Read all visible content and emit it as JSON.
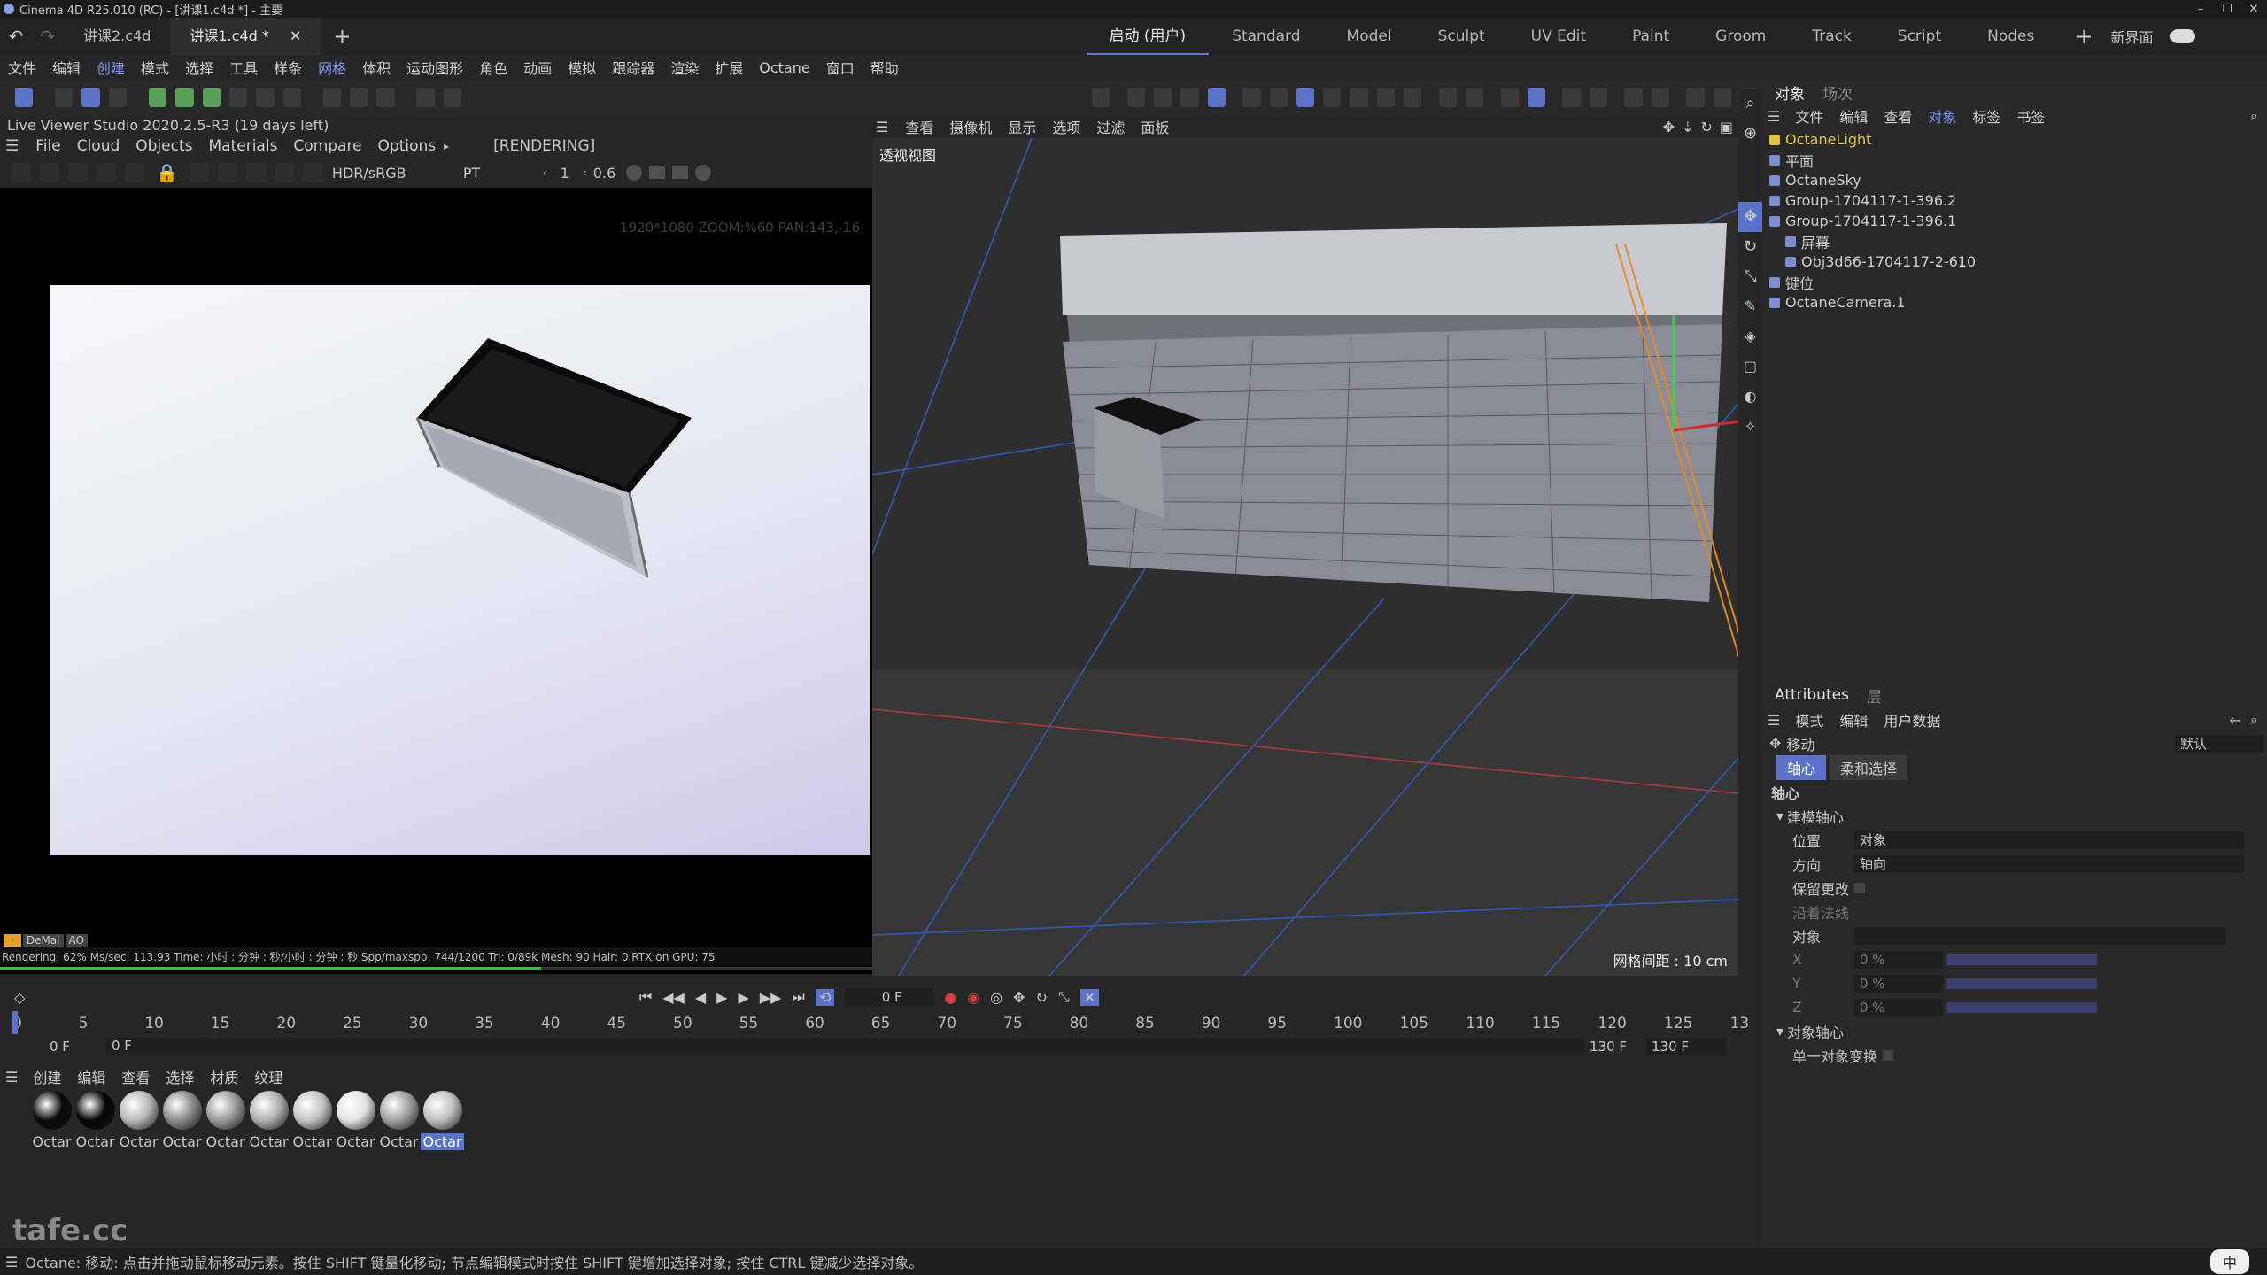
{
  "title_bar": {
    "text": "Cinema 4D R25.010 (RC) - [讲课1.c4d *] - 主要"
  },
  "doc_tabs": [
    {
      "label": "讲课2.c4d"
    },
    {
      "label": "讲课1.c4d *"
    }
  ],
  "layout_tabs": [
    "启动 (用户)",
    "Standard",
    "Model",
    "Sculpt",
    "UV Edit",
    "Paint",
    "Groom",
    "Track",
    "Script",
    "Nodes"
  ],
  "new_layout": "新界面",
  "main_menu": [
    "文件",
    "编辑",
    "创建",
    "模式",
    "选择",
    "工具",
    "样条",
    "网格",
    "体积",
    "运动图形",
    "角色",
    "动画",
    "模拟",
    "跟踪器",
    "渲染",
    "扩展",
    "Octane",
    "窗口",
    "帮助"
  ],
  "live_viewer": {
    "title": "Live Viewer Studio 2020.2.5-R3 (19 days left)",
    "menu": [
      "File",
      "Cloud",
      "Objects",
      "Materials",
      "Compare",
      "Options"
    ],
    "status_tag": "[RENDERING]",
    "color_space": "HDR/sRGB",
    "mode": "PT",
    "value1": "1",
    "value2": "0.6",
    "info": "1920*1080 ZOOM:%60  PAN:143,-16",
    "badges": [
      "DeMai",
      "AO"
    ],
    "status_line": "Rendering: 62%  Ms/sec: 113.93   Time: 小时 : 分钟 : 秒/小时 : 分钟 : 秒   Spp/maxspp: 744/1200   Tri: 0/89k   Mesh: 90   Hair: 0   RTX:on      GPU:    75",
    "progress": 0.62
  },
  "viewport": {
    "menu": [
      "查看",
      "摄像机",
      "显示",
      "选项",
      "过滤",
      "面板"
    ],
    "label": "透视视图",
    "grid_info": "网格间距 : 10 cm"
  },
  "object_panel": {
    "tabs": [
      "对象",
      "场次"
    ],
    "menu": [
      "文件",
      "编辑",
      "查看",
      "对象",
      "标签",
      "书签"
    ],
    "objects": [
      {
        "name": "OctaneLight",
        "indent": 0,
        "highlight": true
      },
      {
        "name": "平面",
        "indent": 0,
        "highlight": false
      },
      {
        "name": "OctaneSky",
        "indent": 0,
        "highlight": false
      },
      {
        "name": "Group-1704117-1-396.2",
        "indent": 0,
        "highlight": false
      },
      {
        "name": "Group-1704117-1-396.1",
        "indent": 0,
        "highlight": false
      },
      {
        "name": "屏幕",
        "indent": 1,
        "highlight": false
      },
      {
        "name": "Obj3d66-1704117-2-610",
        "indent": 1,
        "highlight": false
      },
      {
        "name": "键位",
        "indent": 0,
        "highlight": false
      },
      {
        "name": "OctaneCamera.1",
        "indent": 0,
        "highlight": false
      }
    ]
  },
  "attributes": {
    "tabs": [
      "Attributes",
      "层"
    ],
    "menu": [
      "模式",
      "编辑",
      "用户数据"
    ],
    "tool": "移动",
    "preset": "默认",
    "subtabs": [
      "轴心",
      "柔和选择"
    ],
    "section": "轴心",
    "group1": "建模轴心",
    "position_label": "位置",
    "position_value": "对象",
    "direction_label": "方向",
    "direction_value": "轴向",
    "keep_label": "保留更改",
    "normal_label": "沿着法线",
    "object_label": "对象",
    "axes": [
      {
        "label": "X",
        "value": "0 %"
      },
      {
        "label": "Y",
        "value": "0 %"
      },
      {
        "label": "Z",
        "value": "0 %"
      }
    ],
    "group2": "对象轴心",
    "single_label": "单一对象变换"
  },
  "timeline": {
    "current_frame": "0 F",
    "ticks": [
      "0",
      "5",
      "10",
      "15",
      "20",
      "25",
      "30",
      "35",
      "40",
      "45",
      "50",
      "55",
      "60",
      "65",
      "70",
      "75",
      "80",
      "85",
      "90",
      "95",
      "100",
      "105",
      "110",
      "115",
      "120",
      "125",
      "13"
    ],
    "start": "0 F",
    "start2": "0 F",
    "end": "130 F",
    "end2": "130 F"
  },
  "material_panel": {
    "menu": [
      "创建",
      "编辑",
      "查看",
      "选择",
      "材质",
      "纹理"
    ],
    "materials": [
      {
        "label": "Octar",
        "color": "#0a0a0a",
        "selected": false
      },
      {
        "label": "Octar",
        "color": "#050505",
        "selected": false
      },
      {
        "label": "Octar",
        "color": "#b8b8b8",
        "selected": false
      },
      {
        "label": "Octar",
        "color": "#8a8a8a",
        "selected": false
      },
      {
        "label": "Octar",
        "color": "#9a9a9a",
        "selected": false
      },
      {
        "label": "Octar",
        "color": "#b0b0b0",
        "selected": false
      },
      {
        "label": "Octar",
        "color": "#c4c4c4",
        "selected": false
      },
      {
        "label": "Octar",
        "color": "#e2e2e2",
        "selected": false
      },
      {
        "label": "Octar",
        "color": "#a0a0a0",
        "selected": false
      },
      {
        "label": "Octar",
        "color": "#c0c0c0",
        "selected": true
      }
    ]
  },
  "status_bar": "Octane:    移动: 点击并拖动鼠标移动元素。按住 SHIFT 键量化移动; 节点编辑模式时按住 SHIFT 键增加选择对象; 按住 CTRL 键减少选择对象。",
  "watermark": "tafe.cc",
  "ime": "中"
}
